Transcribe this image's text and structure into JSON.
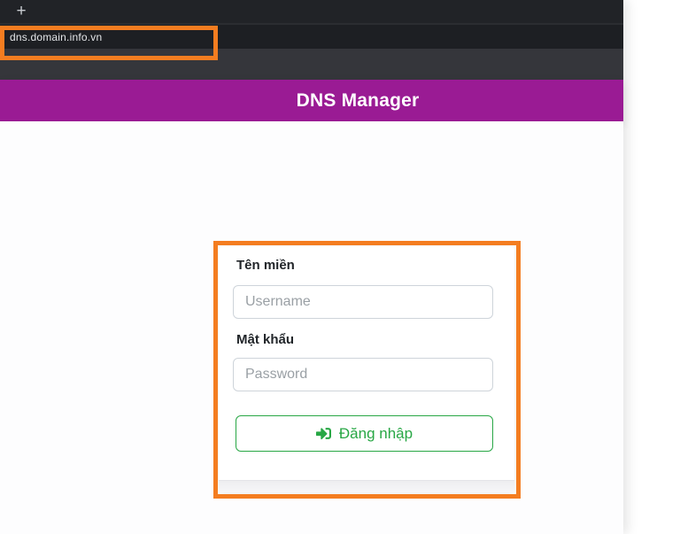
{
  "browser": {
    "new_tab_button": "+",
    "address_url": "dns.domain.info.vn"
  },
  "header": {
    "title": "DNS Manager"
  },
  "login_form": {
    "domain_label": "Tên miền",
    "username_placeholder": "Username",
    "password_label": "Mật khẩu",
    "password_placeholder": "Password",
    "login_button_label": "Đăng nhập"
  },
  "icons": {
    "new_tab_icon": "plus-icon",
    "login_button_icon": "sign-in-icon"
  },
  "colors": {
    "header_background": "#9a1b94",
    "annotation_orange": "#f47d20",
    "button_green": "#28a745",
    "tab_strip": "#212327",
    "address_row": "#1d1f23",
    "toolbar_row": "#35363b"
  }
}
